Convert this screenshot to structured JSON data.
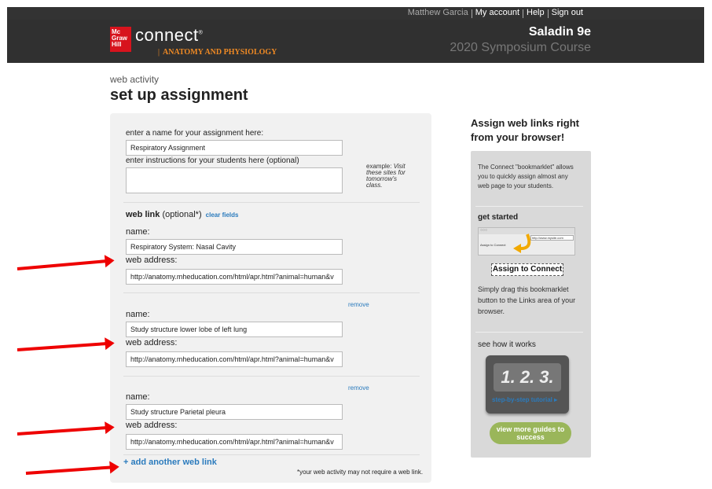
{
  "topbar": {
    "user": "Matthew Garcia",
    "my_account": "My account",
    "help": "Help",
    "sign_out": "Sign out"
  },
  "header": {
    "logo_text": [
      "Mc",
      "Graw",
      "Hill"
    ],
    "brand": "connect",
    "subject": "ANATOMY AND PHYSIOLOGY",
    "book": "Saladin 9e",
    "course": "2020 Symposium Course"
  },
  "page": {
    "pre_title": "web activity",
    "title": "set up assignment"
  },
  "form": {
    "name_label": "enter a name for your assignment here:",
    "name_value": "Respiratory Assignment",
    "instructions_label": "enter instructions for your students here (optional)",
    "instructions_value": "",
    "hint": "example: Visit these sites for tomorrow's class.",
    "hint_prefix": "example: ",
    "hint_italic": "Visit these sites for tomorrow’s class.",
    "web_link_heading": "web link",
    "web_link_optional": " (optional*)",
    "clear_fields": "clear fields",
    "links": [
      {
        "name_label": "name:",
        "name_value": "Respiratory System: Nasal Cavity",
        "address_label": "web address:",
        "address_value": "http://anatomy.mheducation.com/html/apr.html?animal=human&v"
      },
      {
        "remove": "remove",
        "name_label": "name:",
        "name_value": "Study structure lower lobe of left lung",
        "address_label": "web address:",
        "address_value": "http://anatomy.mheducation.com/html/apr.html?animal=human&v"
      },
      {
        "remove": "remove",
        "name_label": "name:",
        "name_value": "Study structure Parietal pleura",
        "address_label": "web address:",
        "address_value": "http://anatomy.mheducation.com/html/apr.html?animal=human&v"
      }
    ],
    "add_link": "+ add another web link",
    "note": "*your web activity may not require a web link."
  },
  "sidebar": {
    "title": "Assign web links right from your browser!",
    "intro": "The Connect \"bookmarklet\" allows you to quickly assign almost any web page to your students.",
    "get_started": "get started",
    "browser_url": "http://www.mysite.com",
    "browser_link": "Assign to Connect",
    "assign_button": "Assign to Connect",
    "drag_text": "Simply drag this bookmarklet button to the Links area of your browser.",
    "see_how": "see how it works",
    "tutorial_numbers": "1. 2. 3.",
    "tutorial_link": "step-by-step tutorial ▸",
    "guides_button": "view more guides to success"
  },
  "colors": {
    "header_bg": "#303030",
    "brand_red": "#d7131d",
    "subject_orange": "#f08a24",
    "link_blue": "#2b7bbd",
    "annotation_arrow": "#e00000",
    "guides_green": "#9ab65a"
  }
}
